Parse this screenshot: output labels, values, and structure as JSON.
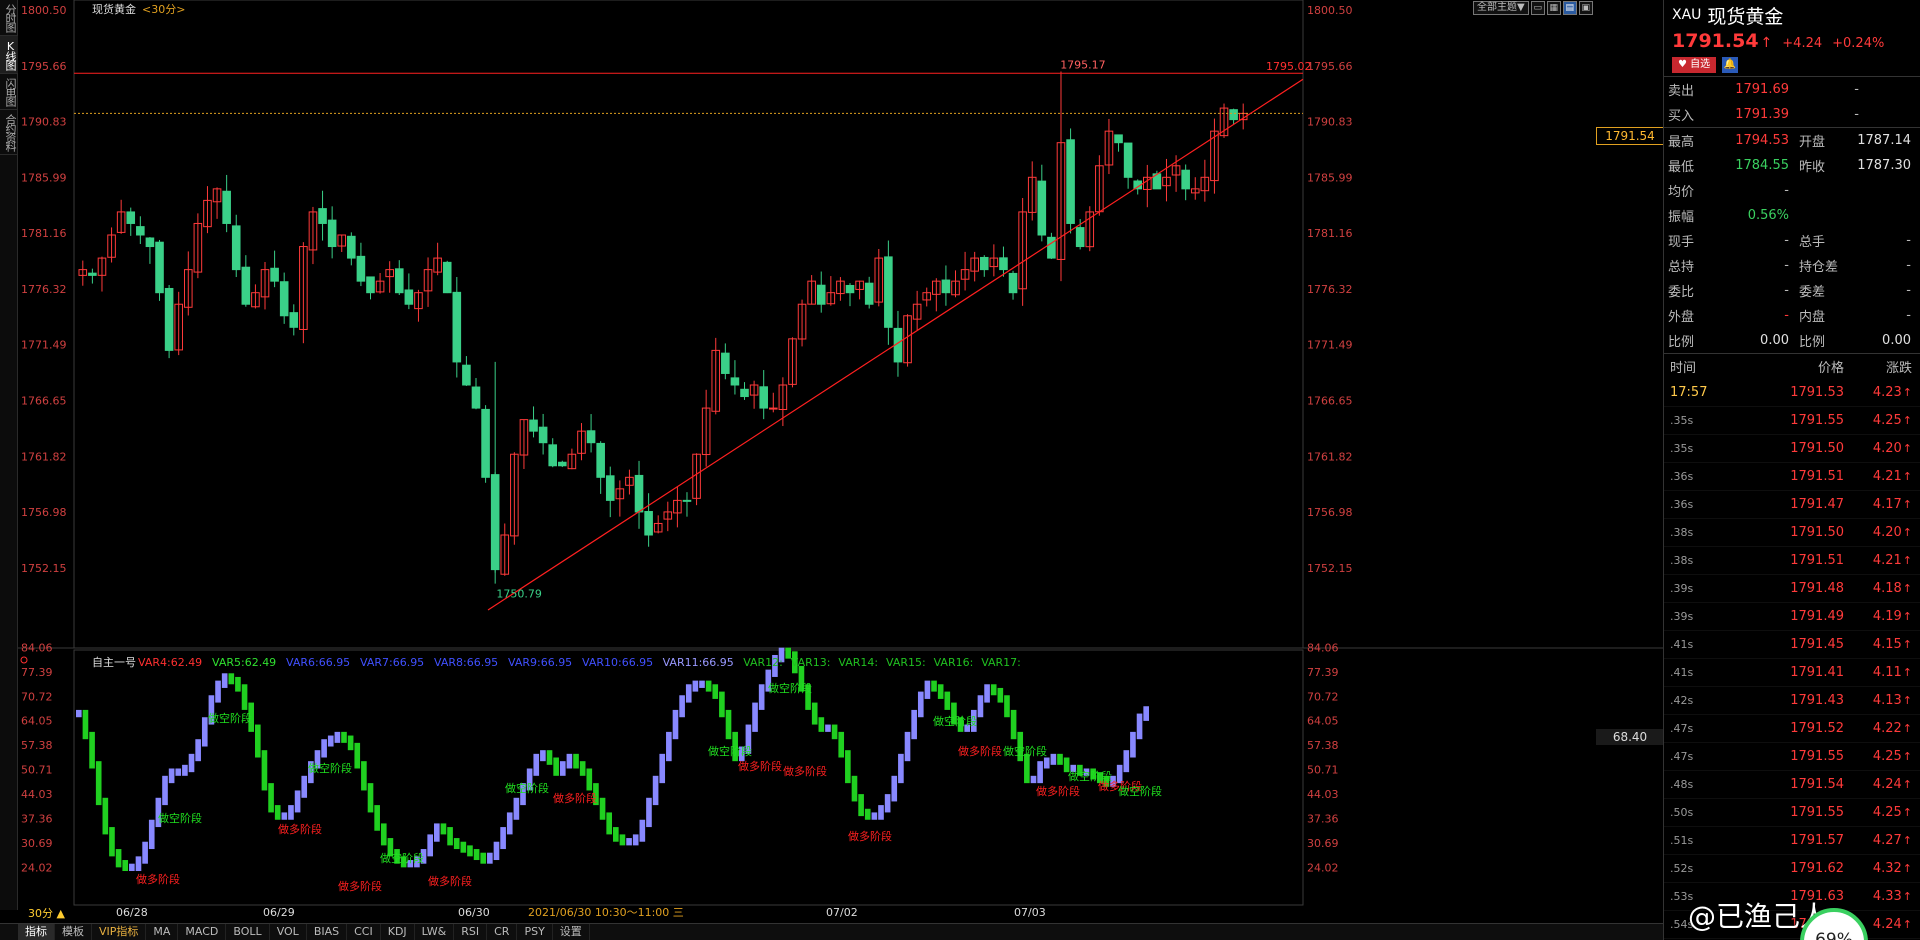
{
  "left_tabs": [
    "分时图",
    "K线图",
    "闪电图",
    "合约资料"
  ],
  "chart": {
    "symbol": "现货黄金",
    "period": "<30分>",
    "theme_button": "全部主题",
    "price_flag": "1791.54",
    "osc_flag": "68.40",
    "period_selector": "30分 ▲",
    "cursor_text": "2021/06/30 10:30～11:00 三",
    "high_label": "1795.17",
    "line_label": "1795.02",
    "low_label": "1750.79",
    "indicator_name": "自主一号",
    "indicator_vars": [
      {
        "text": "VAR4:62.49",
        "color": "#ff3030"
      },
      {
        "text": "VAR5:62.49",
        "color": "#30e030"
      },
      {
        "text": "VAR6:66.95",
        "color": "#4050ff"
      },
      {
        "text": "VAR7:66.95",
        "color": "#4050ff"
      },
      {
        "text": "VAR8:66.95",
        "color": "#4050ff"
      },
      {
        "text": "VAR9:66.95",
        "color": "#4050ff"
      },
      {
        "text": "VAR10:66.95",
        "color": "#4050ff"
      },
      {
        "text": "VAR11:66.95",
        "color": "#9898ff"
      },
      {
        "text": "VAR12:",
        "color": "#20c020"
      },
      {
        "text": "VAR13:",
        "color": "#20c020"
      },
      {
        "text": "VAR14:",
        "color": "#20c020"
      },
      {
        "text": "VAR15:",
        "color": "#20c020"
      },
      {
        "text": "VAR16:",
        "color": "#20c020"
      },
      {
        "text": "VAR17:",
        "color": "#20c020"
      }
    ],
    "date_labels": [
      "06/28",
      "06/29",
      "06/30",
      "07/02",
      "07/03"
    ],
    "phase_labels": [
      {
        "text": "做空阶段",
        "color": "#20e020"
      },
      {
        "text": "做多阶段",
        "color": "#ff2020"
      }
    ]
  },
  "chart_data": [
    {
      "type": "candlestick",
      "title": "现货黄金 <30分>",
      "y_ticks": [
        "1800.50",
        "1795.66",
        "1790.83",
        "1785.99",
        "1781.16",
        "1776.32",
        "1771.49",
        "1766.65",
        "1761.82",
        "1756.98",
        "1752.15"
      ],
      "ylim": [
        1748.5,
        1800.5
      ],
      "x_dates": [
        "06/28",
        "06/29",
        "06/30",
        "07/02",
        "07/03"
      ],
      "high": 1795.17,
      "low": 1750.79,
      "current": 1791.54,
      "resistance": 1795.02,
      "price_path": [
        1778,
        1777.5,
        1779,
        1781,
        1783,
        1782,
        1781,
        1780,
        1776,
        1771,
        1775,
        1778,
        1782,
        1784,
        1785,
        1782,
        1778,
        1775,
        1776,
        1778,
        1777,
        1774,
        1773,
        1780,
        1783,
        1782,
        1780,
        1781,
        1779,
        1777,
        1776,
        1777,
        1778,
        1776,
        1775,
        1776,
        1778,
        1779,
        1776,
        1770,
        1768,
        1766,
        1760,
        1752,
        1755,
        1762,
        1765,
        1764,
        1763,
        1761,
        1761,
        1762,
        1764,
        1763,
        1760,
        1758,
        1759,
        1760,
        1757,
        1755,
        1756,
        1757,
        1758,
        1758,
        1762,
        1766,
        1771,
        1769,
        1768,
        1767,
        1768,
        1766,
        1766,
        1768,
        1772,
        1775,
        1777,
        1775,
        1776,
        1777,
        1776,
        1777,
        1775,
        1779,
        1773,
        1770,
        1774,
        1775,
        1776,
        1777,
        1776,
        1777,
        1778,
        1779,
        1778,
        1779,
        1778,
        1776,
        1783,
        1786,
        1781,
        1779,
        1789,
        1782,
        1780,
        1783,
        1787,
        1790,
        1789,
        1786,
        1785,
        1786,
        1785,
        1786,
        1787,
        1785,
        1785,
        1786,
        1790,
        1792,
        1791,
        1791.54
      ]
    },
    {
      "type": "bar",
      "title": "自主一号",
      "y_ticks": [
        "84.06",
        "77.39",
        "70.72",
        "64.05",
        "57.38",
        "50.71",
        "44.03",
        "37.36",
        "30.69",
        "24.02"
      ],
      "ylim": [
        20,
        85
      ],
      "values": [
        66,
        60,
        52,
        42,
        34,
        28,
        25,
        24,
        24,
        26,
        30,
        36,
        42,
        48,
        50,
        50,
        51,
        54,
        58,
        64,
        70,
        74,
        76,
        75,
        73,
        68,
        62,
        55,
        46,
        40,
        38,
        38,
        40,
        44,
        48,
        52,
        55,
        58,
        59,
        60,
        59,
        57,
        52,
        46,
        40,
        35,
        31,
        28,
        26,
        25,
        25,
        26,
        28,
        32,
        35,
        34,
        31,
        30,
        29,
        28,
        27,
        26,
        27,
        30,
        34,
        38,
        42,
        46,
        50,
        54,
        55,
        53,
        50,
        52,
        54,
        52,
        50,
        46,
        42,
        38,
        34,
        32,
        31,
        31,
        32,
        36,
        42,
        48,
        54,
        60,
        66,
        70,
        73,
        74,
        74,
        73,
        71,
        66,
        60,
        54,
        56,
        62,
        68,
        73,
        77,
        81,
        83,
        82,
        78,
        73,
        68,
        64,
        62,
        62,
        60,
        55,
        48,
        43,
        39,
        38,
        38,
        40,
        43,
        48,
        54,
        60,
        66,
        71,
        74,
        73,
        71,
        68,
        64,
        62,
        62,
        66,
        70,
        73,
        72,
        70,
        66,
        60,
        54,
        48,
        48,
        52,
        53,
        54,
        53,
        51,
        51,
        50,
        50,
        49,
        48,
        47,
        48,
        51,
        55,
        60,
        65,
        67
      ]
    }
  ],
  "panel": {
    "code": "XAU",
    "name": "现货黄金",
    "price": "1791.54",
    "arrow": "↑",
    "change": "+4.24",
    "change_pct": "+0.24%",
    "fav_label": "♥ 自选",
    "alert_label": "🔔",
    "ask": {
      "label": "卖出",
      "price": "1791.69",
      "vol": "-"
    },
    "bid": {
      "label": "买入",
      "price": "1791.39",
      "vol": "-"
    },
    "stats": [
      {
        "l1": "最高",
        "v1": "1794.53",
        "c1": "red",
        "l2": "开盘",
        "v2": "1787.14",
        "c2": "white"
      },
      {
        "l1": "最低",
        "v1": "1784.55",
        "c1": "green",
        "l2": "昨收",
        "v2": "1787.30",
        "c2": "white"
      },
      {
        "l1": "均价",
        "v1": "-",
        "c1": "grey",
        "l2": "",
        "v2": "",
        "c2": "white"
      },
      {
        "l1": "振幅",
        "v1": "0.56%",
        "c1": "green",
        "l2": "",
        "v2": "",
        "c2": "white"
      },
      {
        "l1": "现手",
        "v1": "-",
        "c1": "grey",
        "l2": "总手",
        "v2": "-",
        "c2": "grey"
      },
      {
        "l1": "总持",
        "v1": "-",
        "c1": "grey",
        "l2": "持仓差",
        "v2": "-",
        "c2": "grey"
      },
      {
        "l1": "委比",
        "v1": "-",
        "c1": "grey",
        "l2": "委差",
        "v2": "-",
        "c2": "grey"
      },
      {
        "l1": "外盘",
        "v1": "-",
        "c1": "red",
        "l2": "内盘",
        "v2": "-",
        "c2": "grey"
      },
      {
        "l1": "比例",
        "v1": "0.00",
        "c1": "white",
        "l2": "比例",
        "v2": "0.00",
        "c2": "white"
      }
    ],
    "tick_headers": [
      "时间",
      "价格",
      "涨跌"
    ],
    "ticks": [
      {
        "time": "17:57",
        "price": "1791.53",
        "chg": "4.23"
      },
      {
        "time": ".35s",
        "price": "1791.55",
        "chg": "4.25"
      },
      {
        "time": ".35s",
        "price": "1791.50",
        "chg": "4.20"
      },
      {
        "time": ".36s",
        "price": "1791.51",
        "chg": "4.21"
      },
      {
        "time": ".36s",
        "price": "1791.47",
        "chg": "4.17"
      },
      {
        "time": ".38s",
        "price": "1791.50",
        "chg": "4.20"
      },
      {
        "time": ".38s",
        "price": "1791.51",
        "chg": "4.21"
      },
      {
        "time": ".39s",
        "price": "1791.48",
        "chg": "4.18"
      },
      {
        "time": ".39s",
        "price": "1791.49",
        "chg": "4.19"
      },
      {
        "time": ".41s",
        "price": "1791.45",
        "chg": "4.15"
      },
      {
        "time": ".41s",
        "price": "1791.41",
        "chg": "4.11"
      },
      {
        "time": ".42s",
        "price": "1791.43",
        "chg": "4.13"
      },
      {
        "time": ".47s",
        "price": "1791.52",
        "chg": "4.22"
      },
      {
        "time": ".47s",
        "price": "1791.55",
        "chg": "4.25"
      },
      {
        "time": ".48s",
        "price": "1791.54",
        "chg": "4.24"
      },
      {
        "time": ".50s",
        "price": "1791.55",
        "chg": "4.25"
      },
      {
        "time": ".51s",
        "price": "1791.57",
        "chg": "4.27"
      },
      {
        "time": ".52s",
        "price": "1791.62",
        "chg": "4.32"
      },
      {
        "time": ".53s",
        "price": "1791.63",
        "chg": "4.33"
      },
      {
        "time": ".54s",
        "price": "1791.54",
        "chg": "4.24"
      }
    ]
  },
  "bottom_bar": [
    "指标",
    "模板",
    "VIP指标",
    "MA",
    "MACD",
    "BOLL",
    "VOL",
    "BIAS",
    "CCI",
    "KDJ",
    "LW&",
    "RSI",
    "CR",
    "PSY",
    "设置"
  ],
  "watermark": "@已渔己人",
  "progress_circle": "69%"
}
